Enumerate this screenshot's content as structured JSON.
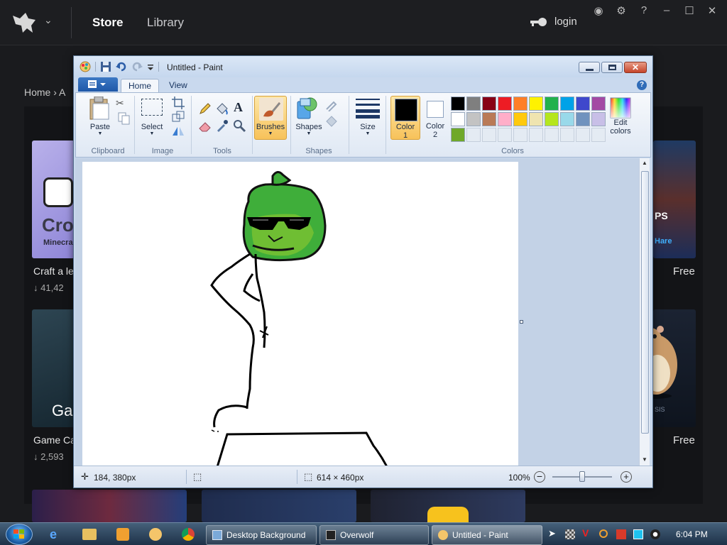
{
  "overwolf": {
    "nav": {
      "store": "Store",
      "library": "Library"
    },
    "login": "login",
    "window_controls": [
      "discord-icon",
      "gear-icon",
      "help-icon",
      "minimize-icon",
      "maximize-icon",
      "close-icon"
    ],
    "breadcrumb": {
      "home": "Home",
      "next": "A"
    },
    "cards": [
      {
        "title": "Craft a le",
        "downloads": "41,42",
        "thumb_text": "Cro",
        "thumb_sub": "Minecra"
      },
      {
        "title": "Game Ca",
        "downloads": "2,593",
        "thumb_text": "Ga"
      }
    ],
    "right_cards": [
      {
        "free": "Free",
        "thumb_text": "PS",
        "thumb_sub": "Hare"
      },
      {
        "free": "Free",
        "thumb_text": "SIS"
      }
    ]
  },
  "paint": {
    "title": "Untitled - Paint",
    "tabs": {
      "home": "Home",
      "view": "View"
    },
    "groups": {
      "clipboard": "Clipboard",
      "image": "Image",
      "tools": "Tools",
      "shapes": "Shapes",
      "colors": "Colors"
    },
    "labels": {
      "paste": "Paste",
      "select": "Select",
      "brushes": "Brushes",
      "shapes": "Shapes",
      "size": "Size",
      "color1_a": "Color",
      "color1_b": "1",
      "color2_a": "Color",
      "color2_b": "2",
      "edit_colors_a": "Edit",
      "edit_colors_b": "colors"
    },
    "color1": "#000000",
    "color2": "#ffffff",
    "palette": [
      "#000000",
      "#7f7f7f",
      "#880015",
      "#ed1c24",
      "#ff7f27",
      "#fff200",
      "#22b14c",
      "#00a2e8",
      "#3f48cc",
      "#a349a4",
      "#ffffff",
      "#c3c3c3",
      "#b97a57",
      "#ffaec9",
      "#ffc90e",
      "#efe4b0",
      "#b5e61d",
      "#99d9ea",
      "#7092be",
      "#c8bfe7",
      "#6fa82a",
      "",
      "",
      "",
      "",
      "",
      "",
      "",
      "",
      ""
    ],
    "status": {
      "cursor": "184, 380px",
      "canvas_size": "614 × 460px",
      "zoom": "100%"
    }
  },
  "taskbar": {
    "buttons": [
      {
        "label": "Desktop Background"
      },
      {
        "label": "Overwolf"
      },
      {
        "label": "Untitled - Paint"
      }
    ],
    "clock": "6:04 PM"
  }
}
